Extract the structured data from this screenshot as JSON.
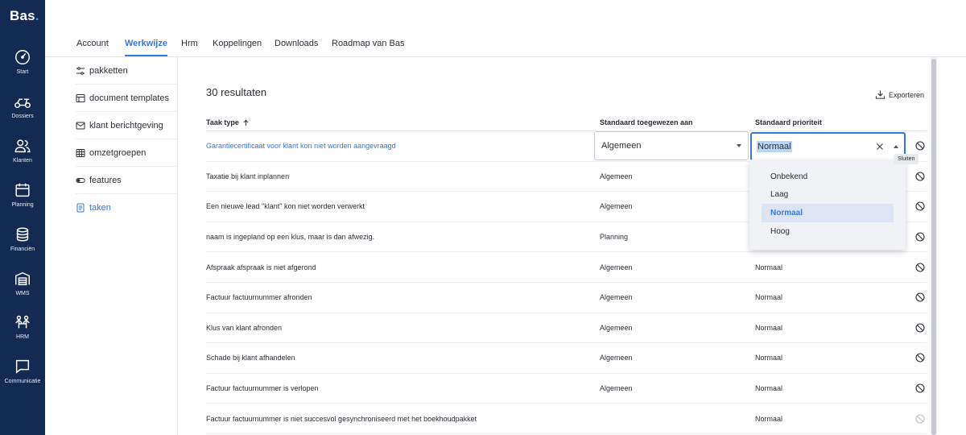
{
  "brand": {
    "name": "Bas",
    "dot": "."
  },
  "rail": [
    {
      "label": "Start",
      "icon": "gauge-icon"
    },
    {
      "label": "Dossiers",
      "icon": "scooter-icon"
    },
    {
      "label": "Klanten",
      "icon": "users-icon"
    },
    {
      "label": "Planning",
      "icon": "calendar-icon"
    },
    {
      "label": "Financiën",
      "icon": "coins-icon"
    },
    {
      "label": "WMS",
      "icon": "warehouse-icon"
    },
    {
      "label": "HRM",
      "icon": "team-icon"
    },
    {
      "label": "Communicatie",
      "icon": "chat-icon"
    }
  ],
  "tabs": [
    "Account",
    "Werkwijze",
    "Hrm",
    "Koppelingen",
    "Downloads",
    "Roadmap van Bas"
  ],
  "active_tab": "Werkwijze",
  "subnav": [
    {
      "label": "pakketten",
      "icon": "sliders-icon"
    },
    {
      "label": "document templates",
      "icon": "table-icon"
    },
    {
      "label": "klant berichtgeving",
      "icon": "mail-icon"
    },
    {
      "label": "omzetgroepen",
      "icon": "grid-icon"
    },
    {
      "label": "features",
      "icon": "toggle-icon"
    },
    {
      "label": "taken",
      "icon": "tasks-icon"
    }
  ],
  "active_subnav": "taken",
  "main": {
    "result_count": "30 resultaten",
    "export_label": "Exporteren",
    "columns": {
      "type": "Taak type",
      "assign": "Standaard toegewezen aan",
      "prio": "Standaard prioriteit"
    }
  },
  "rows": [
    {
      "type": "Garantiecertificaat voor klant kon niet worden aangevraagd",
      "assign": "Algemeen",
      "prio": "Normaal",
      "link": true
    },
    {
      "type": "Taxatie bij klant inplannen",
      "assign": "Algemeen",
      "prio": ""
    },
    {
      "type": "Een nieuwe lead \"klant\" kon niet worden verwerkt",
      "assign": "Algemeen",
      "prio": ""
    },
    {
      "type": "naam is ingepland op een klus, maar is dan afwezig.",
      "assign": "Planning",
      "prio": ""
    },
    {
      "type": "Afspraak afspraak is niet afgerond",
      "assign": "Algemeen",
      "prio": "Normaal"
    },
    {
      "type": "Factuur factuurnummer afronden",
      "assign": "Algemeen",
      "prio": "Normaal"
    },
    {
      "type": "Klus van klant afronden",
      "assign": "Algemeen",
      "prio": "Normaal"
    },
    {
      "type": "Schade bij klant afhandelen",
      "assign": "Algemeen",
      "prio": "Normaal"
    },
    {
      "type": "Factuur factuurnummer is verlopen",
      "assign": "Algemeen",
      "prio": "Normaal"
    },
    {
      "type": "Factuur factuurnummer is niet succesvol gesynchroniseerd met het boekhoudpakket",
      "assign": "",
      "prio": "Normaal"
    }
  ],
  "priority_select": {
    "value": "Normaal",
    "tooltip": "Sluiten",
    "options": [
      "Onbekend",
      "Laag",
      "Normaal",
      "Hoog"
    ],
    "selected": "Normaal"
  },
  "colors": {
    "rail": "#132a52",
    "accent": "#3678d8"
  }
}
